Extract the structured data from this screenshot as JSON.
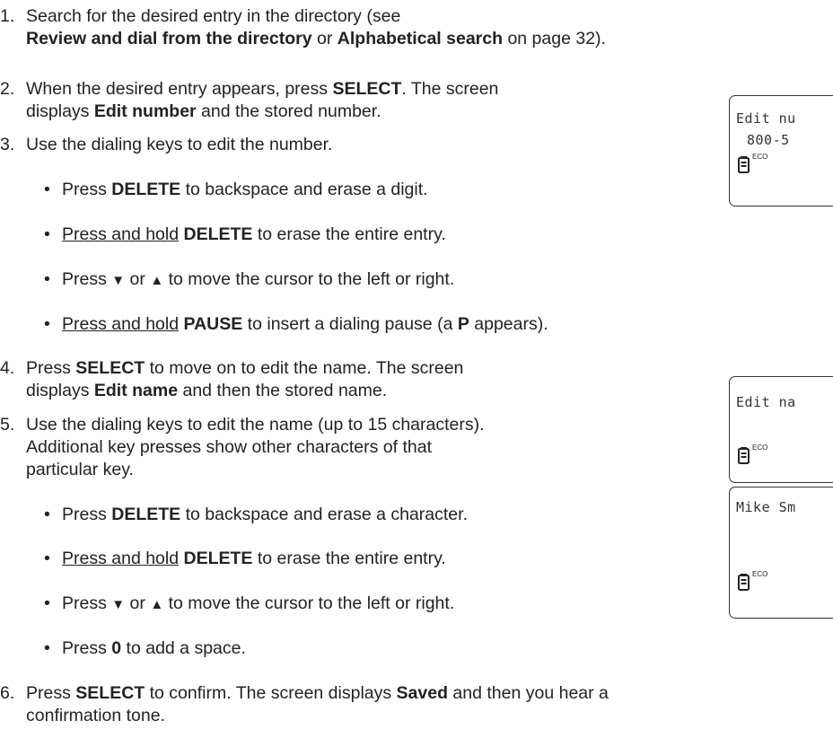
{
  "steps": {
    "s1": {
      "num": "1.",
      "a": "Search for the desired entry in the directory (see",
      "b1": "Review and dial from the directory",
      "b2": " or ",
      "b3": "Alphabetical search",
      "b4": " on page 32)."
    },
    "s2": {
      "num": "2.",
      "a1": "When the desired entry appears, press ",
      "a2": "SELECT",
      "a3": ". The screen",
      "b1": "displays ",
      "b2": "Edit number",
      "b3": " and the stored number."
    },
    "s3": {
      "num": "3.",
      "a": "Use the dialing keys to edit the number.",
      "bullets": [
        {
          "p1": "Press ",
          "p2": "DELETE",
          "p3": " to backspace and erase a digit."
        },
        {
          "u": "Press and hold",
          "p2": "DELETE",
          "p3": " to erase the entire entry."
        },
        {
          "p1": "Press ",
          "down": "▼",
          "or": " or ",
          "up": "▲",
          "p3": " to move the cursor to the left or right."
        },
        {
          "u": "Press and hold",
          "p2": "PAUSE",
          "p3": " to insert a dialing pause (a ",
          "p4": "P",
          "p5": " appears)."
        }
      ]
    },
    "s4": {
      "num": "4.",
      "a1": "Press ",
      "a2": "SELECT",
      "a3": " to move on to edit the name. The screen",
      "b1": "displays ",
      "b2": "Edit name",
      "b3": " and then the stored name."
    },
    "s5": {
      "num": "5.",
      "a": "Use the dialing keys to edit the name (up to 15 characters).",
      "b": "Additional key presses show other characters of that",
      "c": "particular key.",
      "bullets": [
        {
          "p1": "Press ",
          "p2": "DELETE",
          "p3": " to backspace and erase a character."
        },
        {
          "u": "Press and hold",
          "p2": "DELETE",
          "p3": " to erase the entire entry."
        },
        {
          "p1": "Press ",
          "down": "▼",
          "or": " or ",
          "up": "▲",
          "p3": " to move the cursor to the left or right."
        },
        {
          "p1": "Press ",
          "p2": "0",
          "p3": " to add a space."
        }
      ]
    },
    "s6": {
      "num": "6.",
      "a1": "Press ",
      "a2": "SELECT",
      "a3": " to confirm. The screen displays ",
      "a4": "Saved",
      "a5": " and then you hear a",
      "b": "confirmation tone."
    }
  },
  "screens": [
    {
      "line1": "Edit nu",
      "line2": "800-5",
      "eco": "ECO"
    },
    {
      "line1": "Edit na",
      "line2": "",
      "eco": "ECO"
    },
    {
      "line1": "Mike Sm",
      "line2": "",
      "eco": "ECO"
    }
  ],
  "bullet_char": "•"
}
